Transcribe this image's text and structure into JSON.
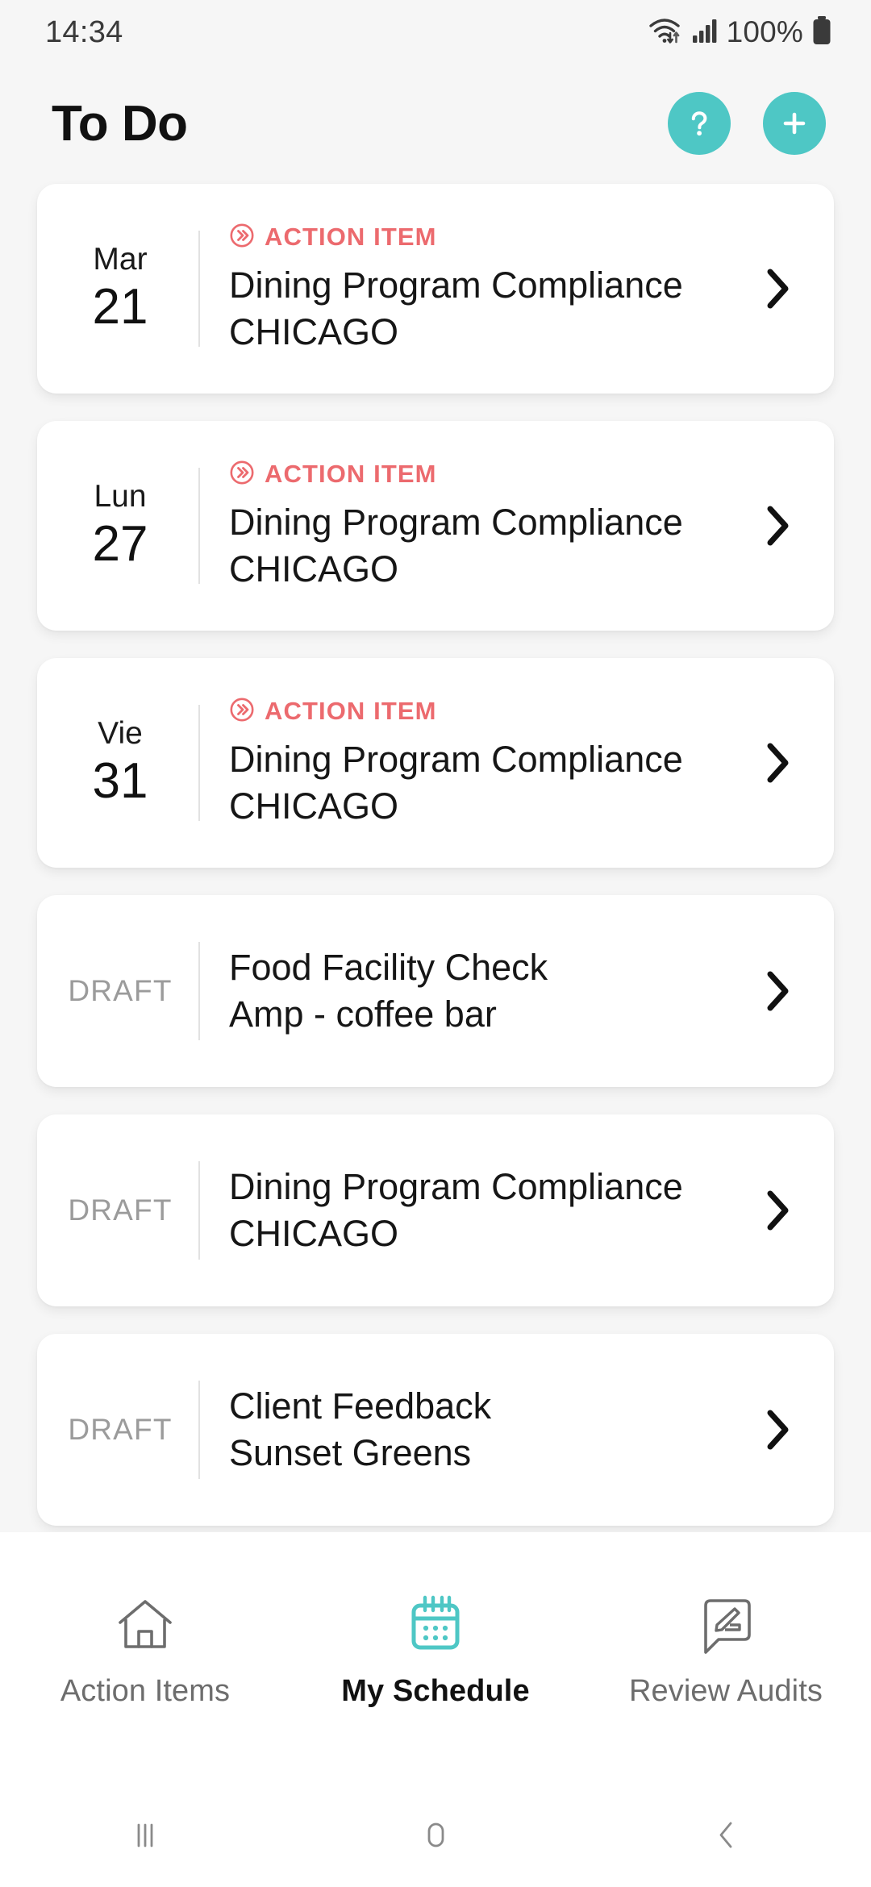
{
  "status_bar": {
    "clock": "14:34",
    "battery_percent": "100%",
    "wifi_icon": "wifi-icon",
    "signal_icon": "signal-bars-icon",
    "battery_icon": "battery-full-icon"
  },
  "header": {
    "title": "To Do",
    "help_button_label": "?",
    "help_icon": "question-mark-icon",
    "add_icon": "plus-icon",
    "accent_color": "#4ec7c5"
  },
  "colors": {
    "accent_teal": "#4ec7c5",
    "action_item_red": "#ec6a6e",
    "draft_gray": "#9b9b9b",
    "page_background": "#f6f6f6",
    "card_background": "#ffffff"
  },
  "cards": [
    {
      "kind": "scheduled",
      "day_of_week": "Mar",
      "day_number": "21",
      "badge": "ACTION ITEM",
      "badge_icon": "double-chevron-circle-icon",
      "title": "Dining Program Compliance",
      "subtitle": "CHICAGO",
      "chevron_icon": "chevron-right-icon"
    },
    {
      "kind": "scheduled",
      "day_of_week": "Lun",
      "day_number": "27",
      "badge": "ACTION ITEM",
      "badge_icon": "double-chevron-circle-icon",
      "title": "Dining Program Compliance",
      "subtitle": "CHICAGO",
      "chevron_icon": "chevron-right-icon"
    },
    {
      "kind": "scheduled",
      "day_of_week": "Vie",
      "day_number": "31",
      "badge": "ACTION ITEM",
      "badge_icon": "double-chevron-circle-icon",
      "title": "Dining Program Compliance",
      "subtitle": "CHICAGO",
      "chevron_icon": "chevron-right-icon"
    },
    {
      "kind": "draft",
      "status_label": "DRAFT",
      "title": "Food Facility Check",
      "subtitle": "Amp - coffee bar",
      "chevron_icon": "chevron-right-icon"
    },
    {
      "kind": "draft",
      "status_label": "DRAFT",
      "title": "Dining Program Compliance",
      "subtitle": "CHICAGO",
      "chevron_icon": "chevron-right-icon"
    },
    {
      "kind": "draft",
      "status_label": "DRAFT",
      "title": "Client Feedback",
      "subtitle": "Sunset Greens",
      "chevron_icon": "chevron-right-icon"
    }
  ],
  "bottom_nav": {
    "items": [
      {
        "label": "Action Items",
        "icon": "home-icon",
        "active": false
      },
      {
        "label": "My Schedule",
        "icon": "calendar-icon",
        "active": true
      },
      {
        "label": "Review Audits",
        "icon": "speech-bubble-pencil-icon",
        "active": false
      }
    ]
  },
  "system_nav": {
    "recents_icon": "recents-icon",
    "home_icon": "home-pill-icon",
    "back_icon": "back-chevron-icon"
  }
}
